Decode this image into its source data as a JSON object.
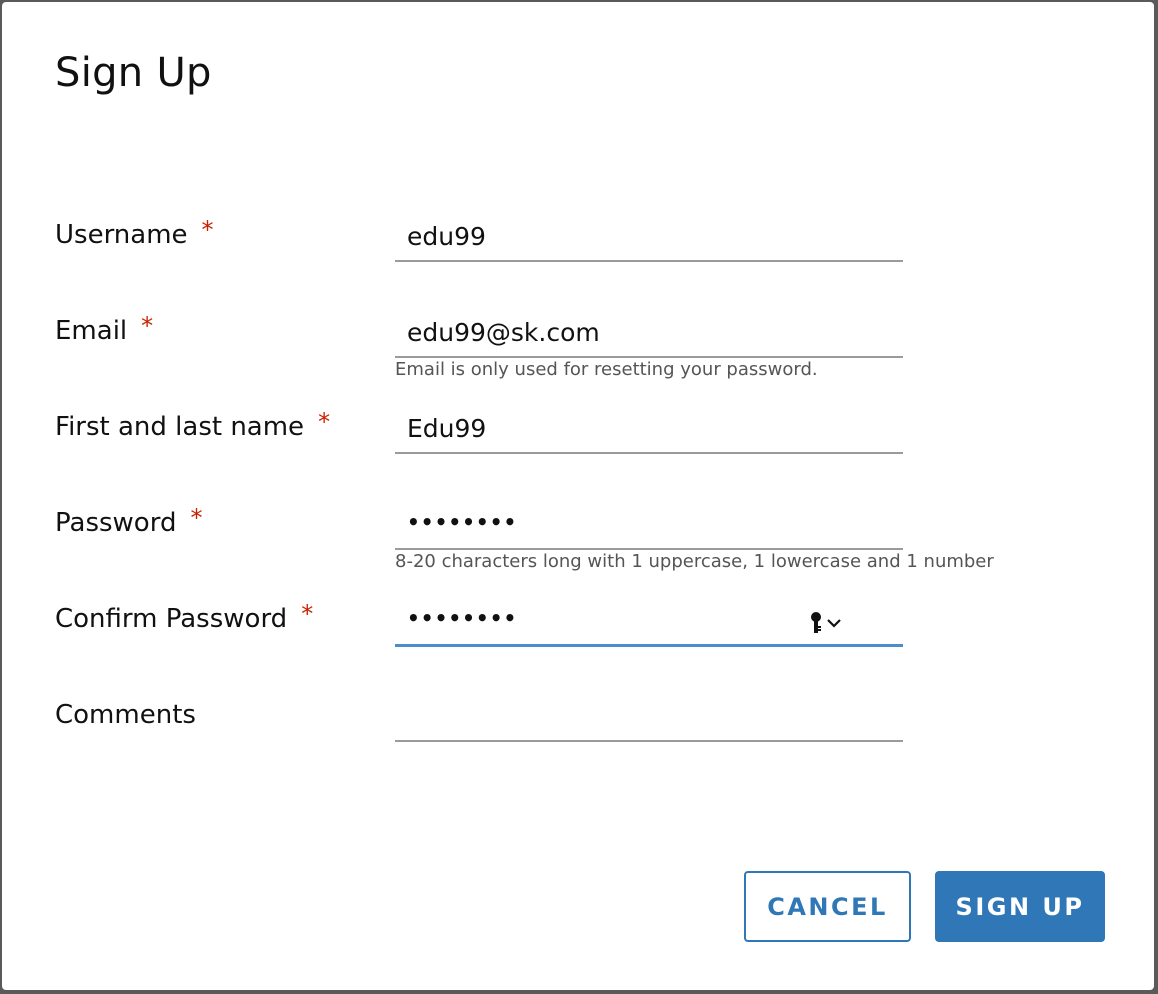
{
  "dialog": {
    "title": "Sign Up"
  },
  "form": {
    "username": {
      "label": "Username",
      "required": "*",
      "value": "edu99"
    },
    "email": {
      "label": "Email",
      "required": "*",
      "value": "edu99@sk.com",
      "helper": "Email is only used for resetting your password."
    },
    "fullname": {
      "label": "First and last name",
      "required": "*",
      "value": "Edu99"
    },
    "password": {
      "label": "Password",
      "required": "*",
      "value": "••••••••",
      "helper": "8-20 characters long with 1 uppercase, 1 lowercase and 1 number"
    },
    "confirm": {
      "label": "Confirm Password",
      "required": "*",
      "value": "••••••••",
      "icon": "key-dropdown-icon"
    },
    "comments": {
      "label": "Comments",
      "value": ""
    }
  },
  "actions": {
    "cancel_label": "CANCEL",
    "signup_label": "SIGN UP"
  },
  "colors": {
    "accent": "#2f77b6",
    "required": "#c92100",
    "active_underline": "#4a8fcb"
  }
}
